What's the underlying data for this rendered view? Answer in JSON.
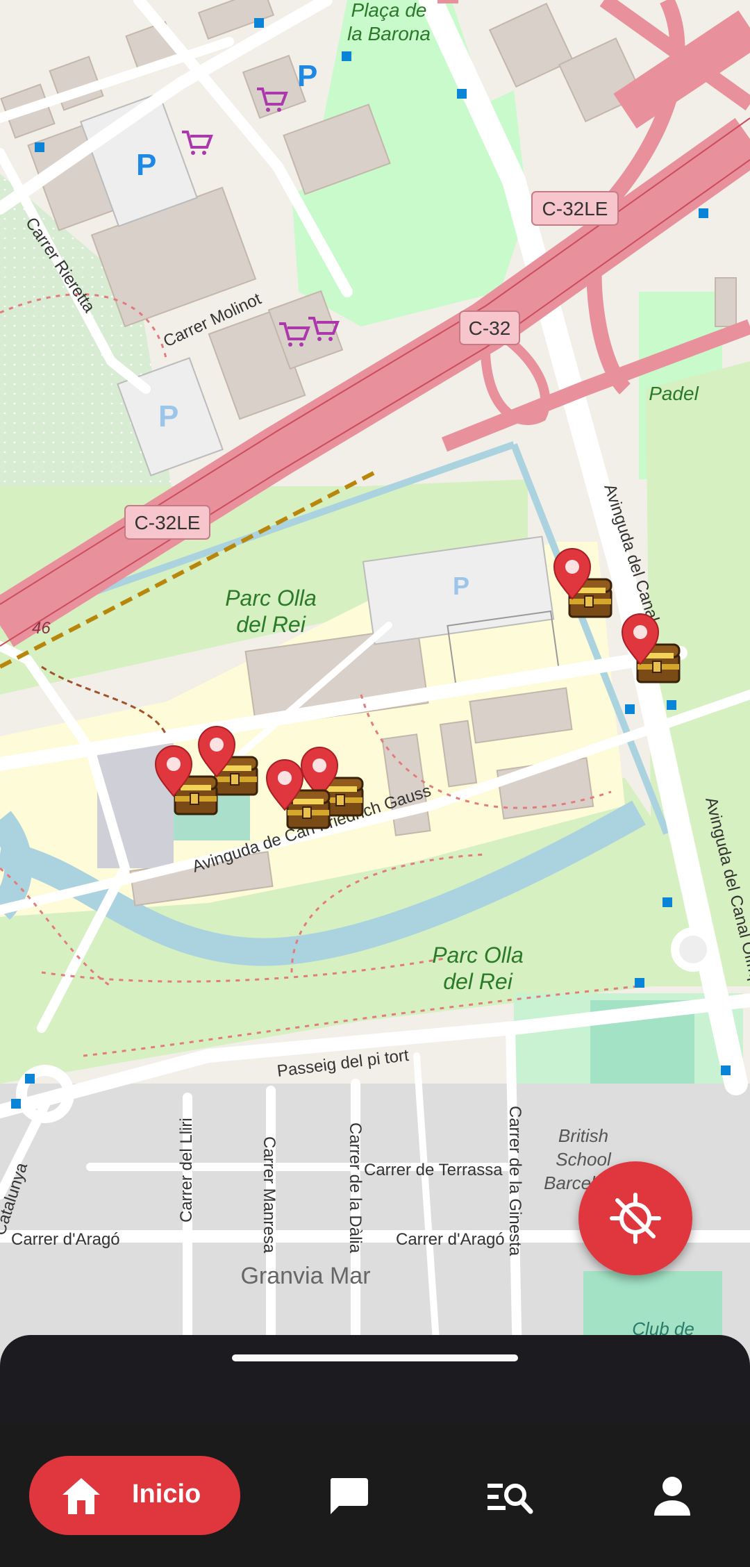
{
  "map": {
    "roads": {
      "c32le_top": "C-32LE",
      "c32": "C-32",
      "c32le_left": "C-32LE",
      "n46": "46"
    },
    "places": {
      "placa_barona_1": "Plaça de",
      "placa_barona_2": "la Barona",
      "padel": "Padel",
      "parc_olla_1a": "Parc Olla",
      "parc_olla_1b": "del Rei",
      "parc_olla_2a": "Parc Olla",
      "parc_olla_2b": "del Rei",
      "british_1": "British",
      "british_2": "School",
      "british_3": "Barcel",
      "club": "Club de",
      "granvia": "Granvia Mar"
    },
    "streets": {
      "rieretta": "Carrer Rieretta",
      "molinot": "Carrer Molinot",
      "canal_1": "Avinguda del Canal",
      "canal_2": "Avinguda del Canal Olímpic",
      "gauss": "Avinguda de Carl Friedrich Gauss",
      "pi_tort": "Passeig del pi tort",
      "lliri": "Carrer del Lliri",
      "manresa": "Carrer Manresa",
      "dalia": "Carrer de la Dàlia",
      "ginesta": "Carrer de la Ginesta",
      "terrassa": "Carrer de Terrassa",
      "arago_1": "Carrer d'Aragó",
      "arago_2": "Carrer d'Aragó",
      "catalunya": "Catalunya"
    },
    "parking": "P",
    "treasure_markers": [
      "treasure-1",
      "treasure-2",
      "treasure-3",
      "treasure-4",
      "treasure-5",
      "treasure-6"
    ]
  },
  "fab": {
    "icon": "location-disabled-icon"
  },
  "nav": {
    "home_label": "Inicio",
    "items": [
      "home-icon",
      "chat-icon",
      "search-list-icon",
      "person-icon"
    ]
  },
  "colors": {
    "accent": "#e0363e",
    "highway": "#e8909c",
    "park": "#c8facc",
    "water": "#aad3df",
    "nav_bg": "#1b1b1b"
  }
}
